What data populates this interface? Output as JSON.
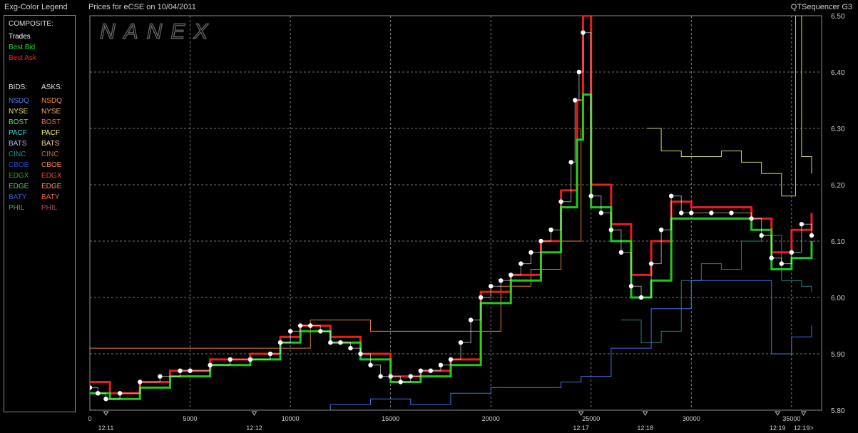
{
  "header": {
    "legend_title": "Exg-Color Legend",
    "chart_title": "Prices for  eCSE  on  10/04/2011",
    "app_name": "QTSequencer G3"
  },
  "legend": {
    "composite_label": "COMPOSITE:",
    "composite": [
      {
        "label": "Trades",
        "color": "#ffffff"
      },
      {
        "label": "Best Bid",
        "color": "#22dd22"
      },
      {
        "label": "Best Ask",
        "color": "#ff2020"
      }
    ],
    "bids_label": "BIDS:",
    "asks_label": "ASKS:",
    "bids": [
      {
        "label": "NSDQ",
        "color": "#4a7cff"
      },
      {
        "label": "NYSE",
        "color": "#e8e860"
      },
      {
        "label": "BOST",
        "color": "#66dd66"
      },
      {
        "label": "PACF",
        "color": "#30e0e0"
      },
      {
        "label": "BATS",
        "color": "#a0c0ff"
      },
      {
        "label": "CINC",
        "color": "#2a8c8c"
      },
      {
        "label": "CBOE",
        "color": "#2848c8"
      },
      {
        "label": "EDGX",
        "color": "#22aa22"
      },
      {
        "label": "EDGE",
        "color": "#66bb66"
      },
      {
        "label": "BATY",
        "color": "#3a5ad0"
      },
      {
        "label": "PHIL",
        "color": "#6a9a3a"
      }
    ],
    "asks": [
      {
        "label": "NSDQ",
        "color": "#ff8c3a"
      },
      {
        "label": "NYSE",
        "color": "#ffb070"
      },
      {
        "label": "BOST",
        "color": "#ff5a5a"
      },
      {
        "label": "PACF",
        "color": "#ffff60"
      },
      {
        "label": "BATS",
        "color": "#ffd080"
      },
      {
        "label": "CINC",
        "color": "#c07050"
      },
      {
        "label": "CBOE",
        "color": "#ff8040"
      },
      {
        "label": "EDGX",
        "color": "#e05030"
      },
      {
        "label": "EDGE",
        "color": "#ff9070"
      },
      {
        "label": "BATY",
        "color": "#e06040"
      },
      {
        "label": "PHIL",
        "color": "#c04070"
      }
    ]
  },
  "watermark": "NANEX",
  "chart_data": {
    "type": "line",
    "title": "Prices for  eCSE  on  10/04/2011",
    "xlabel": "",
    "ylabel": "",
    "xlim": [
      0,
      36500
    ],
    "ylim": [
      5.8,
      6.5
    ],
    "y_ticks": [
      "6.50",
      "6.40",
      "6.30",
      "6.20",
      "6.10",
      "6.00",
      "5.90",
      "5.80"
    ],
    "x_ticks": [
      "0",
      "5000",
      "10000",
      "15000",
      "20000",
      "25000",
      "30000",
      "35000"
    ],
    "time_ticks": [
      {
        "x": 800,
        "label": "12:11"
      },
      {
        "x": 8200,
        "label": "12:12"
      },
      {
        "x": 24500,
        "label": "12:17"
      },
      {
        "x": 27700,
        "label": "12:18"
      },
      {
        "x": 34300,
        "label": "12:19"
      },
      {
        "x": 35600,
        "label": "12:19>"
      }
    ],
    "grid": true,
    "series": [
      {
        "name": "Trades",
        "color": "#ffffff",
        "x": [
          0,
          400,
          800,
          1500,
          2500,
          3500,
          4500,
          5000,
          6000,
          7000,
          8000,
          9000,
          9500,
          10000,
          10500,
          11000,
          11500,
          12000,
          12500,
          13000,
          13500,
          14000,
          14500,
          15000,
          15500,
          16000,
          16500,
          17000,
          17500,
          18000,
          18500,
          19000,
          19500,
          20000,
          20500,
          21000,
          21500,
          22000,
          22500,
          23000,
          23500,
          24000,
          24200,
          24400,
          24600,
          25000,
          25500,
          26000,
          26500,
          27000,
          27500,
          28000,
          28500,
          29000,
          29500,
          30000,
          31000,
          32000,
          33000,
          33500,
          34000,
          34500,
          35000,
          35500,
          36000
        ],
        "y": [
          5.84,
          5.83,
          5.82,
          5.83,
          5.85,
          5.86,
          5.87,
          5.87,
          5.88,
          5.89,
          5.89,
          5.9,
          5.92,
          5.94,
          5.95,
          5.95,
          5.94,
          5.92,
          5.92,
          5.91,
          5.9,
          5.88,
          5.86,
          5.86,
          5.85,
          5.86,
          5.87,
          5.87,
          5.88,
          5.89,
          5.92,
          5.96,
          6.0,
          6.02,
          6.03,
          6.04,
          6.06,
          6.08,
          6.1,
          6.12,
          6.17,
          6.24,
          6.35,
          6.4,
          6.47,
          6.18,
          6.15,
          6.12,
          6.08,
          6.02,
          6.0,
          6.06,
          6.12,
          6.18,
          6.15,
          6.15,
          6.15,
          6.15,
          6.14,
          6.11,
          6.07,
          6.06,
          6.08,
          6.13,
          6.11
        ]
      },
      {
        "name": "Best Bid",
        "color": "#22dd22",
        "x": [
          0,
          1000,
          2500,
          4000,
          6000,
          8000,
          9500,
          10500,
          12000,
          13500,
          15000,
          16500,
          18000,
          19500,
          21000,
          22500,
          23500,
          24300,
          24600,
          25000,
          26000,
          27000,
          28000,
          29000,
          30000,
          31000,
          32000,
          33000,
          34000,
          35000,
          36000
        ],
        "y": [
          5.83,
          5.82,
          5.84,
          5.86,
          5.88,
          5.89,
          5.92,
          5.94,
          5.92,
          5.89,
          5.85,
          5.86,
          5.88,
          5.99,
          6.03,
          6.08,
          6.16,
          6.28,
          6.36,
          6.16,
          6.1,
          6.0,
          6.03,
          6.14,
          6.14,
          6.14,
          6.14,
          6.12,
          6.05,
          6.07,
          6.1
        ]
      },
      {
        "name": "Best Ask",
        "color": "#ff2020",
        "x": [
          0,
          1000,
          2500,
          4000,
          6000,
          8000,
          9500,
          10500,
          12000,
          13500,
          15000,
          16500,
          18000,
          19500,
          21000,
          22500,
          23500,
          24300,
          24600,
          25000,
          26000,
          27000,
          28000,
          29000,
          30000,
          31000,
          32000,
          33000,
          34000,
          35000,
          36000
        ],
        "y": [
          5.85,
          5.83,
          5.85,
          5.87,
          5.89,
          5.9,
          5.93,
          5.95,
          5.93,
          5.9,
          5.86,
          5.87,
          5.89,
          6.01,
          6.04,
          6.1,
          6.19,
          6.35,
          6.5,
          6.2,
          6.13,
          6.04,
          6.1,
          6.17,
          6.16,
          6.16,
          6.16,
          6.14,
          6.08,
          6.12,
          6.15
        ]
      },
      {
        "name": "NSDQ",
        "color": "#4a7cff",
        "x": [
          10500,
          12000,
          14000,
          16000,
          18000,
          20000,
          22000,
          23500,
          24500,
          26000,
          28000,
          30000,
          32000,
          34000,
          35000,
          36000
        ],
        "y": [
          5.8,
          5.81,
          5.82,
          5.81,
          5.83,
          5.84,
          5.84,
          5.85,
          5.86,
          5.91,
          5.98,
          6.03,
          6.03,
          5.9,
          5.93,
          5.95
        ]
      },
      {
        "name": "CINC",
        "color": "#2a8c8c",
        "x": [
          26500,
          27500,
          28500,
          29500,
          30500,
          31500,
          32500,
          33500,
          34500,
          35500,
          36000
        ],
        "y": [
          5.96,
          5.92,
          5.94,
          6.03,
          6.06,
          6.05,
          6.1,
          6.11,
          6.03,
          6.02,
          6.01
        ]
      },
      {
        "name": "NYSE",
        "color": "#e8e860",
        "x": [
          27800,
          28500,
          29500,
          30500,
          31500,
          32500,
          33500,
          34500,
          35200,
          35500,
          36000
        ],
        "y": [
          6.3,
          6.26,
          6.25,
          6.25,
          6.26,
          6.24,
          6.22,
          6.18,
          6.5,
          6.25,
          6.22
        ]
      },
      {
        "name": "NSDQ ask",
        "color": "#ff8c3a",
        "x": [
          0,
          5000,
          10000,
          11000,
          14000,
          14000,
          19500,
          20500,
          22000,
          23500,
          24500
        ],
        "y": [
          5.91,
          5.91,
          5.91,
          5.96,
          5.96,
          5.94,
          5.94,
          6.02,
          6.05,
          6.1,
          6.3
        ]
      }
    ]
  }
}
